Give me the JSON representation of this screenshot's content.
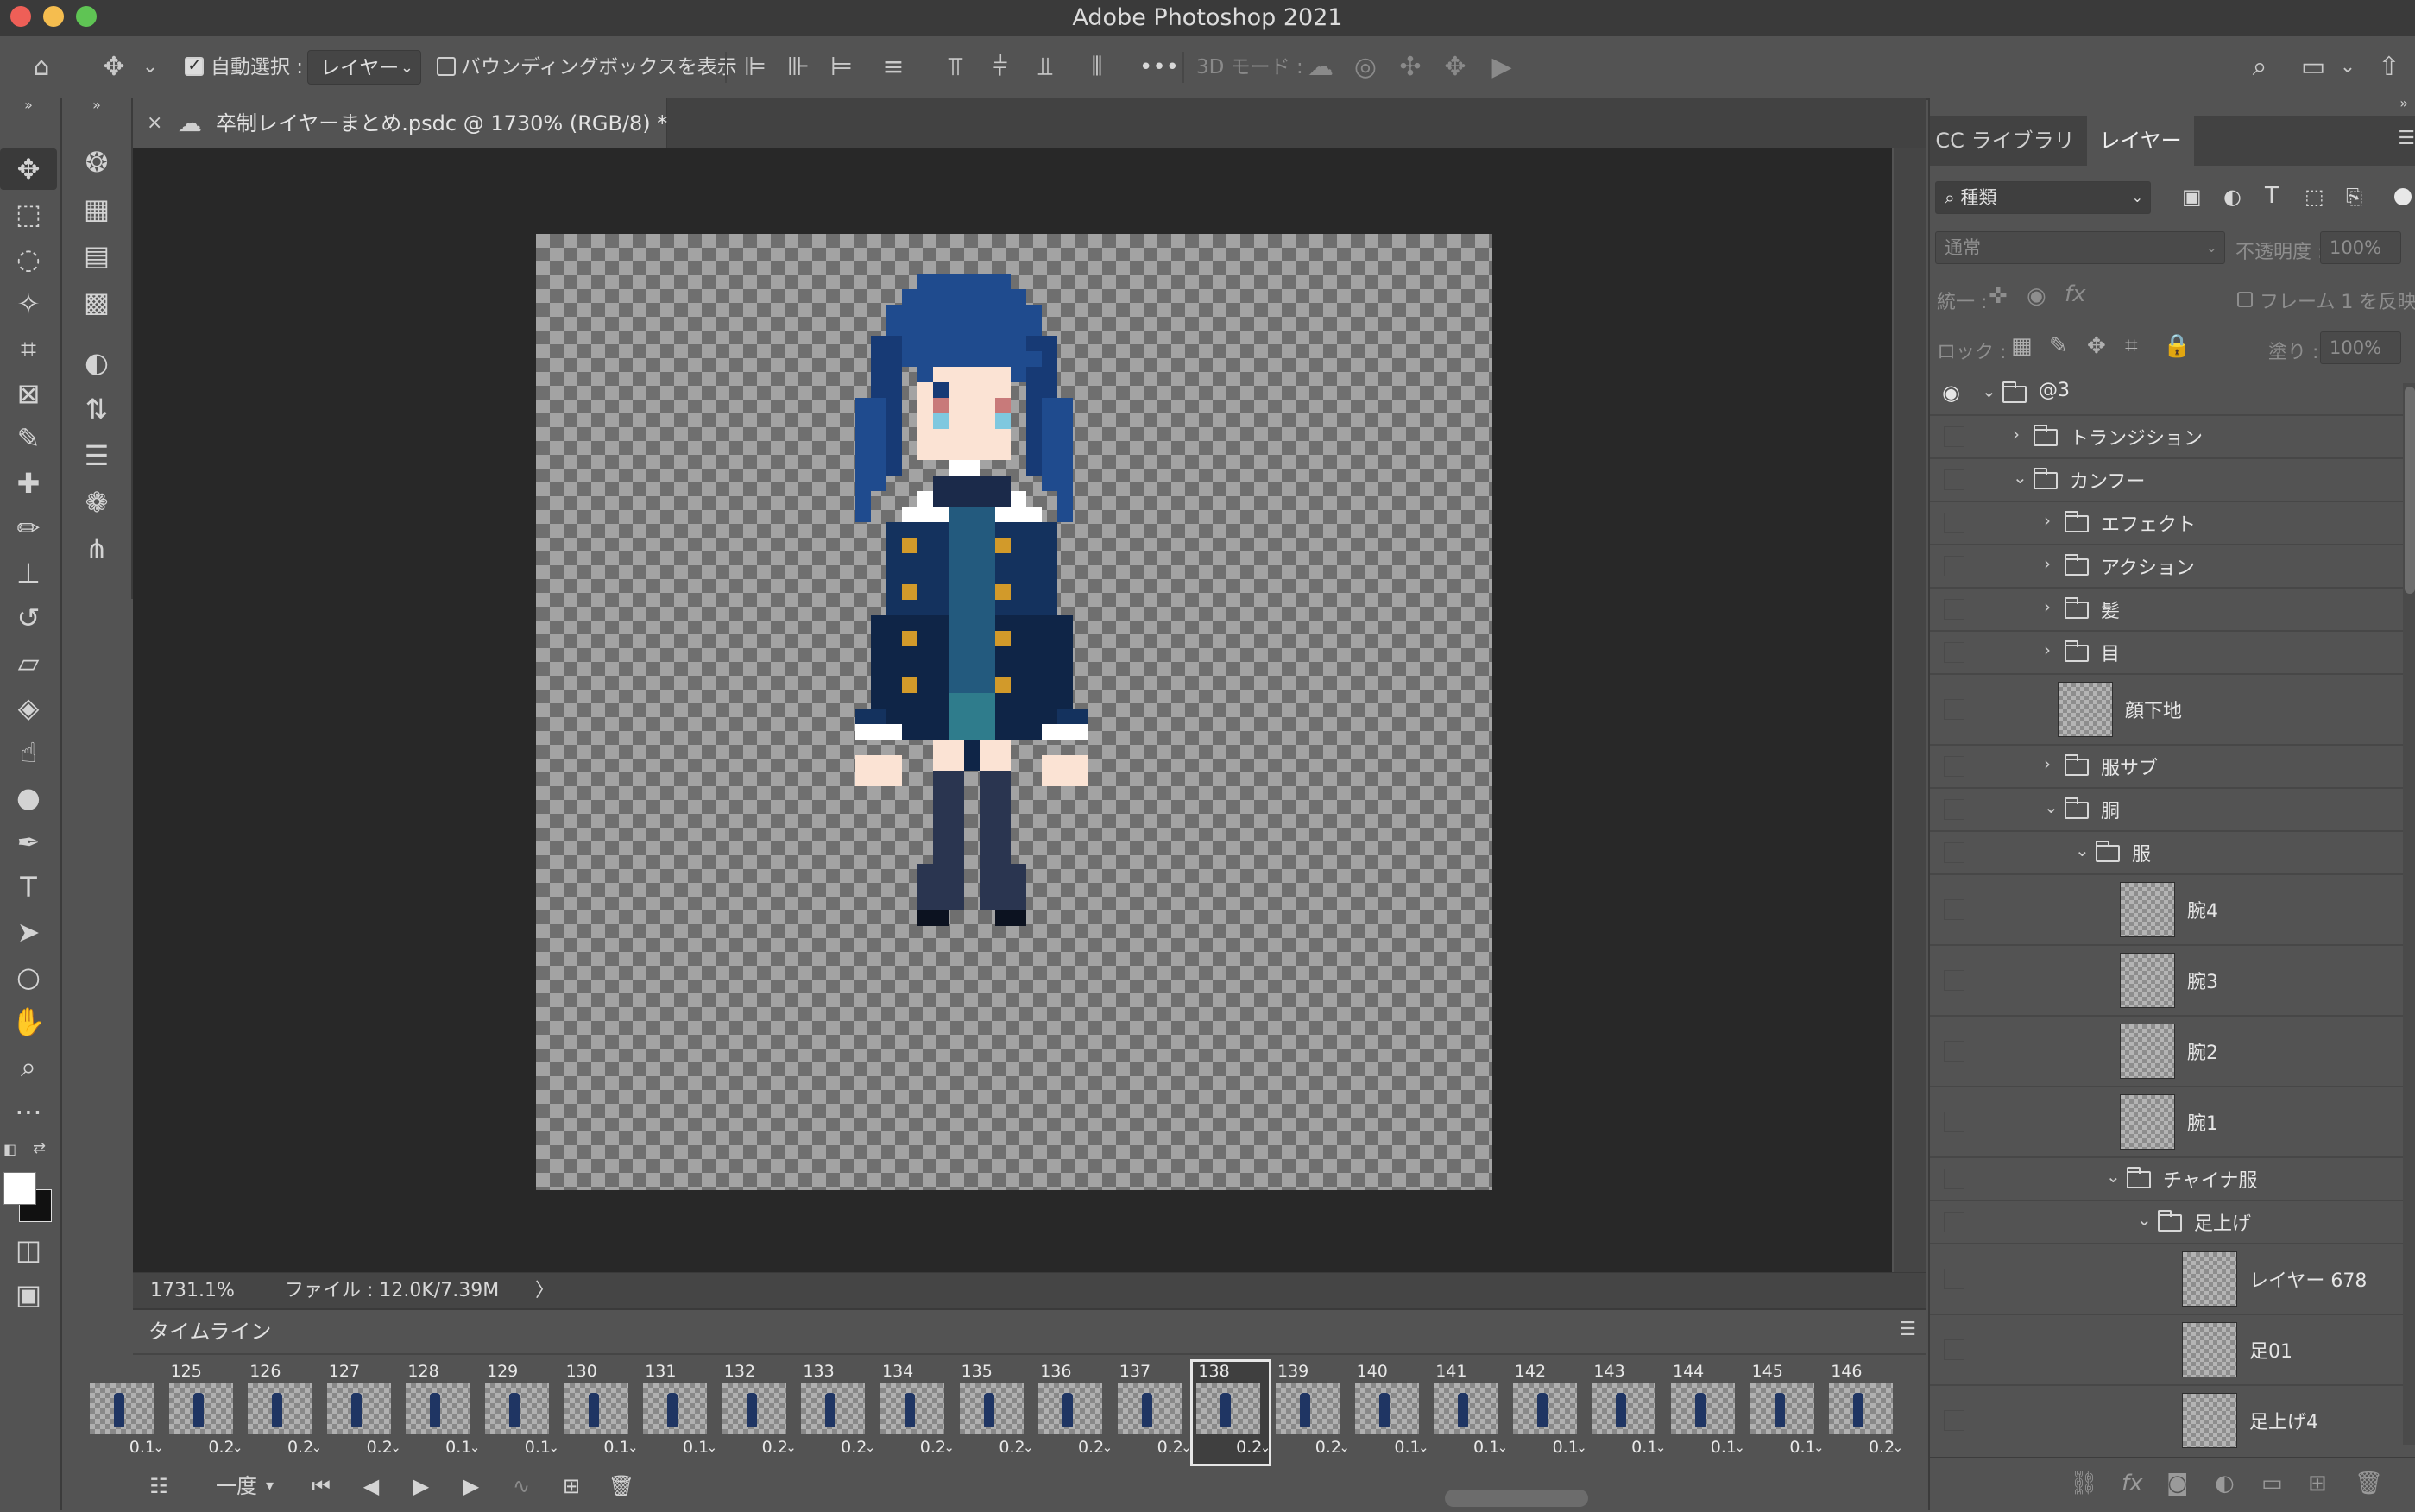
{
  "window": {
    "title": "Adobe Photoshop 2021",
    "traffic_colors": [
      "#ee5f57",
      "#f5bd4f",
      "#5fc454"
    ]
  },
  "options_bar": {
    "auto_select_label": "自動選択 :",
    "auto_select_value": "レイヤー",
    "bbox_label": "バウンディングボックスを表示",
    "mode_3d_label": "3D モード :",
    "more": "•••"
  },
  "document": {
    "tab_title": "卒制レイヤーまとめ.psdc @ 1730% (RGB/8) *",
    "close": "×",
    "zoom": "1731.1%",
    "file_info": "ファイル : 12.0K/7.39M",
    "status_arrow": "〉"
  },
  "timeline": {
    "title": "タイムライン",
    "loop_value": "一度",
    "frames": [
      {
        "num": "",
        "delay": "0.1"
      },
      {
        "num": "125",
        "delay": "0.2"
      },
      {
        "num": "126",
        "delay": "0.2"
      },
      {
        "num": "127",
        "delay": "0.2"
      },
      {
        "num": "128",
        "delay": "0.1"
      },
      {
        "num": "129",
        "delay": "0.1"
      },
      {
        "num": "130",
        "delay": "0.1"
      },
      {
        "num": "131",
        "delay": "0.1"
      },
      {
        "num": "132",
        "delay": "0.2"
      },
      {
        "num": "133",
        "delay": "0.2"
      },
      {
        "num": "134",
        "delay": "0.2"
      },
      {
        "num": "135",
        "delay": "0.2"
      },
      {
        "num": "136",
        "delay": "0.2"
      },
      {
        "num": "137",
        "delay": "0.2"
      },
      {
        "num": "138",
        "delay": "0.2"
      },
      {
        "num": "139",
        "delay": "0.2"
      },
      {
        "num": "140",
        "delay": "0.1"
      },
      {
        "num": "141",
        "delay": "0.1"
      },
      {
        "num": "142",
        "delay": "0.1"
      },
      {
        "num": "143",
        "delay": "0.1"
      },
      {
        "num": "144",
        "delay": "0.1"
      },
      {
        "num": "145",
        "delay": "0.1"
      },
      {
        "num": "146",
        "delay": "0.2"
      }
    ],
    "selected_frame": "138"
  },
  "panel": {
    "tab_cc": "CC ライブラリ",
    "tab_layers": "レイヤー",
    "filter_value": "種類",
    "blend_mode": "通常",
    "opacity_label": "不透明度 :",
    "opacity_value": "100%",
    "unify_label": "統一 :",
    "propagate_label": "フレーム 1 を反映",
    "lock_label": "ロック :",
    "fill_label": "塗り :",
    "fill_value": "100%"
  },
  "layers": [
    {
      "name": "@3",
      "type": "group",
      "open": true,
      "depth": 0,
      "visible": true
    },
    {
      "name": "トランジション",
      "type": "group",
      "open": false,
      "depth": 1
    },
    {
      "name": "カンフー",
      "type": "group",
      "open": true,
      "depth": 1
    },
    {
      "name": "エフェクト",
      "type": "group",
      "open": false,
      "depth": 2
    },
    {
      "name": "アクション",
      "type": "group",
      "open": false,
      "depth": 2
    },
    {
      "name": "髪",
      "type": "group",
      "open": false,
      "depth": 2
    },
    {
      "name": "目",
      "type": "group",
      "open": false,
      "depth": 2
    },
    {
      "name": "顔下地",
      "type": "layer",
      "depth": 2
    },
    {
      "name": "服サブ",
      "type": "group",
      "open": false,
      "depth": 2
    },
    {
      "name": "胴",
      "type": "group",
      "open": true,
      "depth": 2
    },
    {
      "name": "服",
      "type": "group",
      "open": true,
      "depth": 3
    },
    {
      "name": "腕4",
      "type": "layer",
      "depth": 4
    },
    {
      "name": "腕3",
      "type": "layer",
      "depth": 4
    },
    {
      "name": "腕2",
      "type": "layer",
      "depth": 4
    },
    {
      "name": "腕1",
      "type": "layer",
      "depth": 4
    },
    {
      "name": "チャイナ服",
      "type": "group",
      "open": true,
      "depth": 4
    },
    {
      "name": "足上げ",
      "type": "group",
      "open": true,
      "depth": 5
    },
    {
      "name": "レイヤー 678",
      "type": "layer",
      "depth": 6
    },
    {
      "name": "足01",
      "type": "layer",
      "depth": 6
    },
    {
      "name": "足上げ4",
      "type": "layer",
      "depth": 6
    }
  ],
  "sprite_colors": {
    "hair": "#1f4b8e",
    "hair_dark": "#173a75",
    "skin": "#fbe3d4",
    "eye": "#7fc8df",
    "brow": "#c87a7a",
    "coat": "#14325e",
    "coat_dark": "#0f2547",
    "inner": "#235a7e",
    "inner_teal": "#2f7c8c",
    "button": "#d29a2a",
    "white": "#ffffff",
    "legs": "#2a3550",
    "shoe": "#0c1220",
    "collar": "#1b2a4a"
  }
}
